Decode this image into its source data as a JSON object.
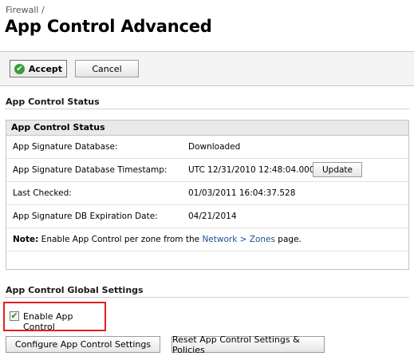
{
  "breadcrumb": "Firewall /",
  "page_title": "App Control Advanced",
  "toolbar": {
    "accept_label": "Accept",
    "cancel_label": "Cancel"
  },
  "status_section": {
    "heading": "App Control Status",
    "panel_title": "App Control Status",
    "rows": [
      {
        "label": "App Signature Database:",
        "value": "Downloaded"
      },
      {
        "label": "App Signature Database Timestamp:",
        "value": "UTC 12/31/2010 12:48:04.000",
        "button": "Update"
      },
      {
        "label": "Last Checked:",
        "value": "01/03/2011 16:04:37.528"
      },
      {
        "label": "App Signature DB Expiration Date:",
        "value": "04/21/2014"
      }
    ],
    "note": {
      "prefix": "Note:",
      "text": " Enable App Control per zone from the ",
      "link": "Network > Zones",
      "suffix": " page."
    }
  },
  "global_section": {
    "heading": "App Control Global Settings",
    "enable_label": "Enable App Control",
    "enable_checked": true,
    "configure_label": "Configure App Control Settings",
    "reset_label": "Reset App Control Settings & Policies"
  },
  "colors": {
    "highlight_border": "#e02020",
    "link": "#1a4f9c",
    "accept_icon": "#3a9c3a"
  }
}
